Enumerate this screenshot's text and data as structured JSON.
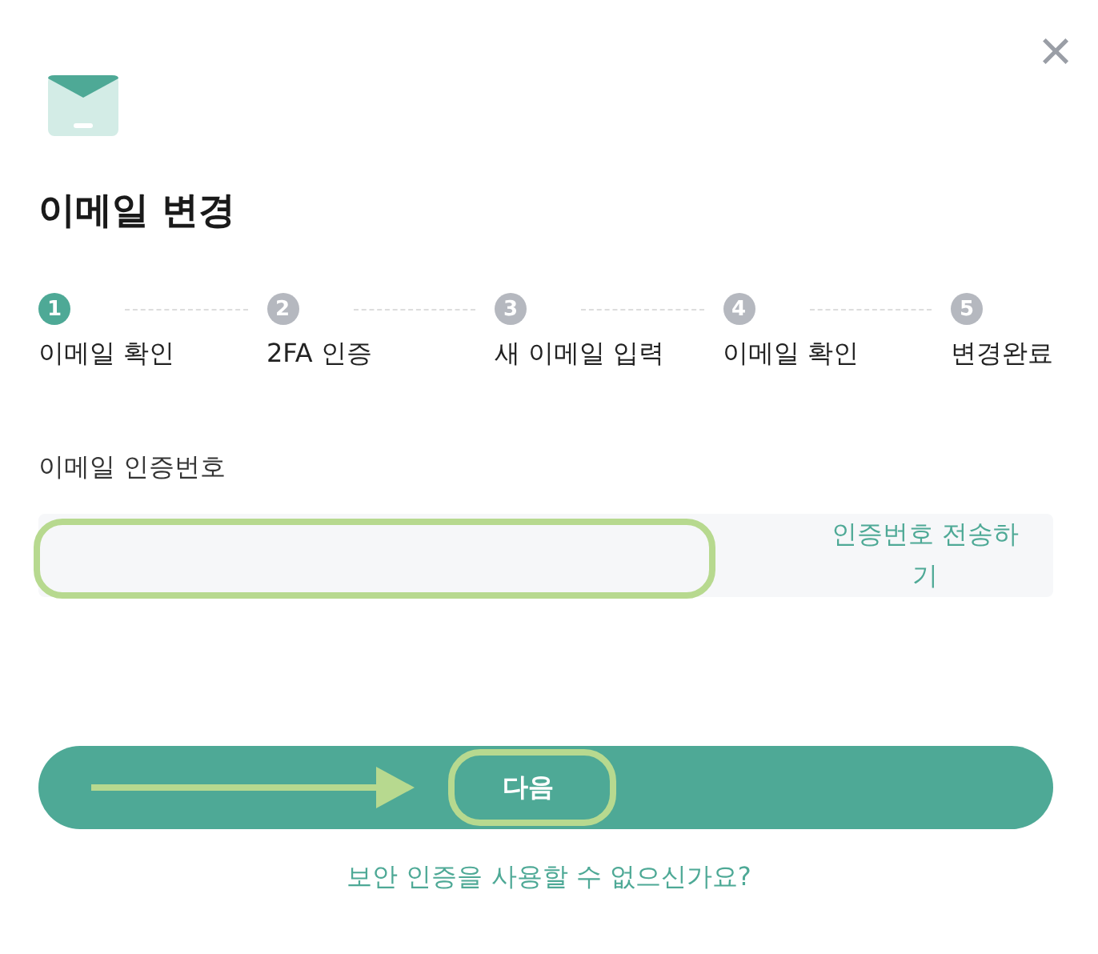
{
  "dialog": {
    "title": "이메일 변경",
    "close": "×"
  },
  "steps": [
    {
      "number": "1",
      "label": "이메일 확인",
      "selected": true
    },
    {
      "number": "2",
      "label": "2FA 인증",
      "selected": false
    },
    {
      "number": "3",
      "label": "새 이메일 입력",
      "selected": false
    },
    {
      "number": "4",
      "label": "이메일 확인",
      "selected": false
    },
    {
      "number": "5",
      "label": "변경완료",
      "selected": false
    }
  ],
  "code_field": {
    "label": "이메일 인증번호",
    "highlighted": true,
    "send_button": "인증번호 전송하기"
  },
  "next_button": {
    "label": "다음",
    "highlighted": true,
    "arrow": true
  },
  "help_link": "보안 인증을 사용할 수 없으신가요?"
}
